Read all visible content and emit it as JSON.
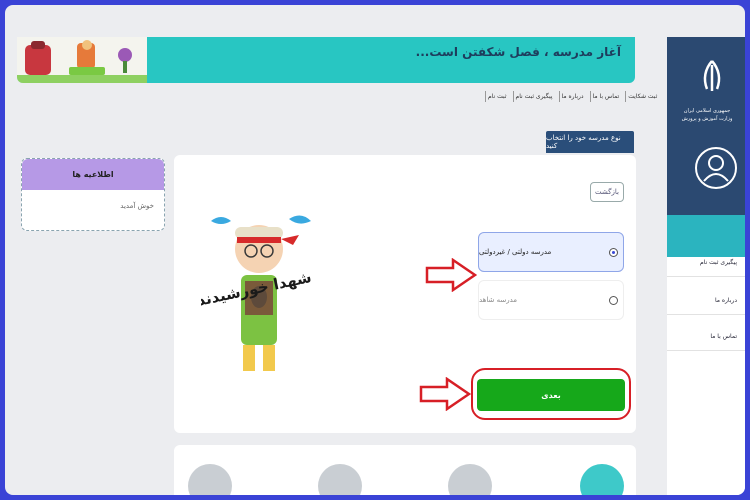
{
  "banner": {
    "title": "آغاز مدرسه ، فصل شکفتن است..."
  },
  "topnav": [
    "ثبت نام",
    "پیگیری ثبت نام",
    "درباره ما",
    "تماس با ما",
    "ثبت شکایت"
  ],
  "main": {
    "tab_label": "نوع مدرسه خود را انتخاب کنید",
    "back_label": "بازگشت",
    "options": [
      {
        "label": "مدرسه دولتی / غیردولتی",
        "selected": true
      },
      {
        "label": "مدرسه شاهد",
        "selected": false
      }
    ],
    "next_label": "بعدی"
  },
  "notice": {
    "title": "اطلاعیه ها",
    "body": "خوش آمدید"
  },
  "sidebar": {
    "org_line1": "جمهوری اسلامی ایران",
    "org_line2": "وزارت آموزش و پرورش",
    "items": [
      "پیگیری ثبت نام",
      "درباره ما",
      "تماس با ما"
    ]
  },
  "illustration": {
    "caption": "شهدا خورشیدند"
  },
  "colors": {
    "accent_green": "#16a81a",
    "teal": "#28c6c2",
    "navy": "#2a4e7a",
    "highlight_red": "#d71f26"
  }
}
